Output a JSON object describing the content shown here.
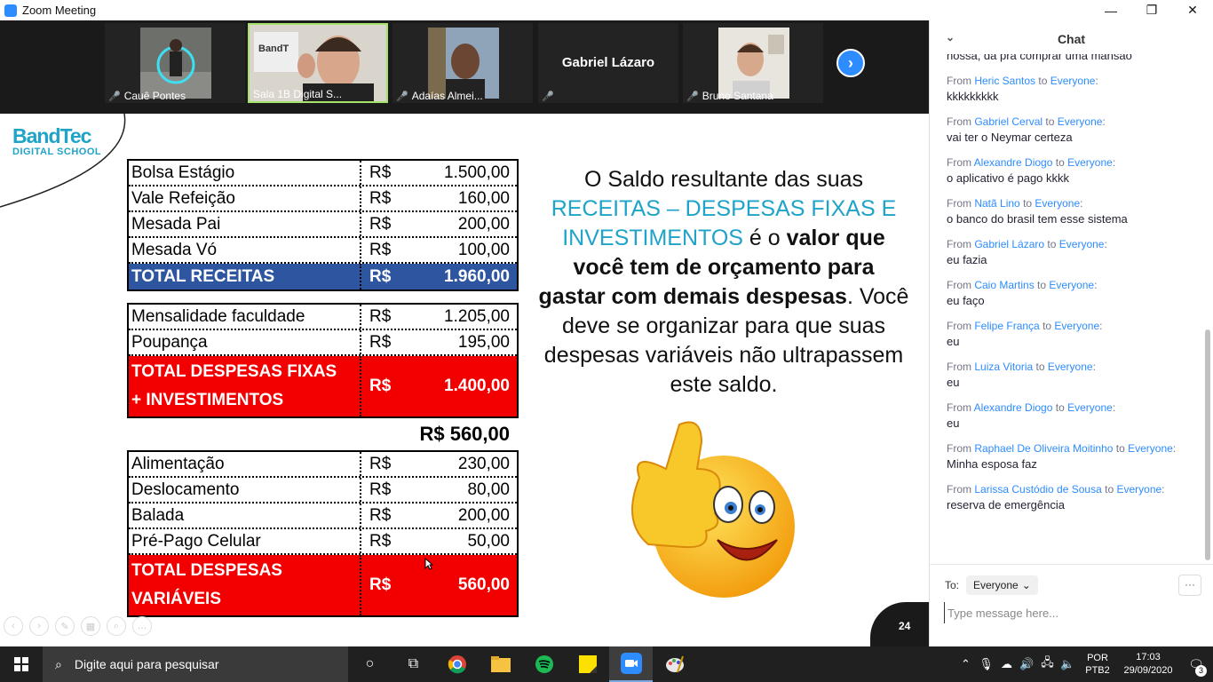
{
  "window": {
    "title": "Zoom Meeting",
    "minimize": "—",
    "restore": "❐",
    "close": "✕"
  },
  "participants": [
    {
      "name": "Cauê Pontes",
      "muted": true
    },
    {
      "name": "Sala 1B Digital S...",
      "muted": false,
      "active": true
    },
    {
      "name": "Adaías Almei...",
      "muted": true
    },
    {
      "name": "Gabriel Lázaro",
      "muted": true,
      "video": false
    },
    {
      "name": "Bruno Santana",
      "muted": true
    }
  ],
  "slide": {
    "logo_top": "BandTec",
    "logo_bottom": "DIGITAL SCHOOL",
    "receitas": [
      {
        "label": "Bolsa Estágio",
        "cur": "R$",
        "value": "1.500,00"
      },
      {
        "label": "Vale Refeição",
        "cur": "R$",
        "value": "160,00"
      },
      {
        "label": "Mesada Pai",
        "cur": "R$",
        "value": "200,00"
      },
      {
        "label": "Mesada Vó",
        "cur": "R$",
        "value": "100,00"
      }
    ],
    "total_receitas": {
      "label": "TOTAL RECEITAS",
      "cur": "R$",
      "value": "1.960,00"
    },
    "fixas": [
      {
        "label": "Mensalidade faculdade",
        "cur": "R$",
        "value": "1.205,00"
      },
      {
        "label": "Poupança",
        "cur": "R$",
        "value": "195,00"
      }
    ],
    "total_fixas": {
      "label1": "TOTAL DESPESAS FIXAS",
      "label2": "+ INVESTIMENTOS",
      "cur": "R$",
      "value": "1.400,00"
    },
    "saldo": "R$ 560,00",
    "variaveis": [
      {
        "label": "Alimentação",
        "cur": "R$",
        "value": "230,00"
      },
      {
        "label": "Deslocamento",
        "cur": "R$",
        "value": "80,00"
      },
      {
        "label": "Balada",
        "cur": "R$",
        "value": "200,00"
      },
      {
        "label": "Pré-Pago Celular",
        "cur": "R$",
        "value": "50,00"
      }
    ],
    "total_variaveis": {
      "label1": "TOTAL DESPESAS",
      "label2": "VARIÁVEIS",
      "cur": "R$",
      "value": "560,00"
    },
    "text": {
      "p1": "O Saldo resultante das suas",
      "p2": "RECEITAS – DESPESAS FIXAS E INVESTIMENTOS",
      "p3": " é o ",
      "p4": "valor que você tem de orçamento para gastar com demais despesas",
      "p5": ". Você deve se organizar para que suas despesas variáveis não ultrapassem este saldo."
    },
    "page_number": "24"
  },
  "chat": {
    "title": "Chat",
    "first_text": "nossa, da pra comprar uma mansao",
    "messages": [
      {
        "from": "Heric Santos",
        "to": "Everyone",
        "text": "kkkkkkkkk"
      },
      {
        "from": "Gabriel Cerval",
        "to": "Everyone",
        "text": "vai ter o Neymar certeza"
      },
      {
        "from": "Alexandre Diogo",
        "to": "Everyone",
        "text": "o aplicativo é pago  kkkk"
      },
      {
        "from": "Natã Lino",
        "to": "Everyone",
        "text": "o banco do brasil tem esse sistema"
      },
      {
        "from": "Gabriel Lázaro",
        "to": "Everyone",
        "text": "eu fazia"
      },
      {
        "from": "Caio Martins",
        "to": "Everyone",
        "text": "eu faço"
      },
      {
        "from": "Felipe França",
        "to": "Everyone",
        "text": "eu"
      },
      {
        "from": "Luiza Vitoria",
        "to": "Everyone",
        "text": "eu"
      },
      {
        "from": "Alexandre Diogo",
        "to": "Everyone",
        "text": "eu"
      },
      {
        "from": "Raphael De Oliveira Moitinho",
        "to": "Everyone",
        "text": "Minha esposa faz"
      },
      {
        "from": "Larissa Custódio de Sousa",
        "to": "Everyone",
        "text": "reserva de emergência"
      }
    ],
    "from_word": "From",
    "to_word": "to",
    "to_label": "To:",
    "to_value": "Everyone",
    "more": "···",
    "input_placeholder": "Type message here..."
  },
  "taskbar": {
    "search_placeholder": "Digite aqui para pesquisar",
    "lang1": "POR",
    "lang2": "PTB2",
    "time": "17:03",
    "date": "29/09/2020",
    "notifications": "3"
  }
}
